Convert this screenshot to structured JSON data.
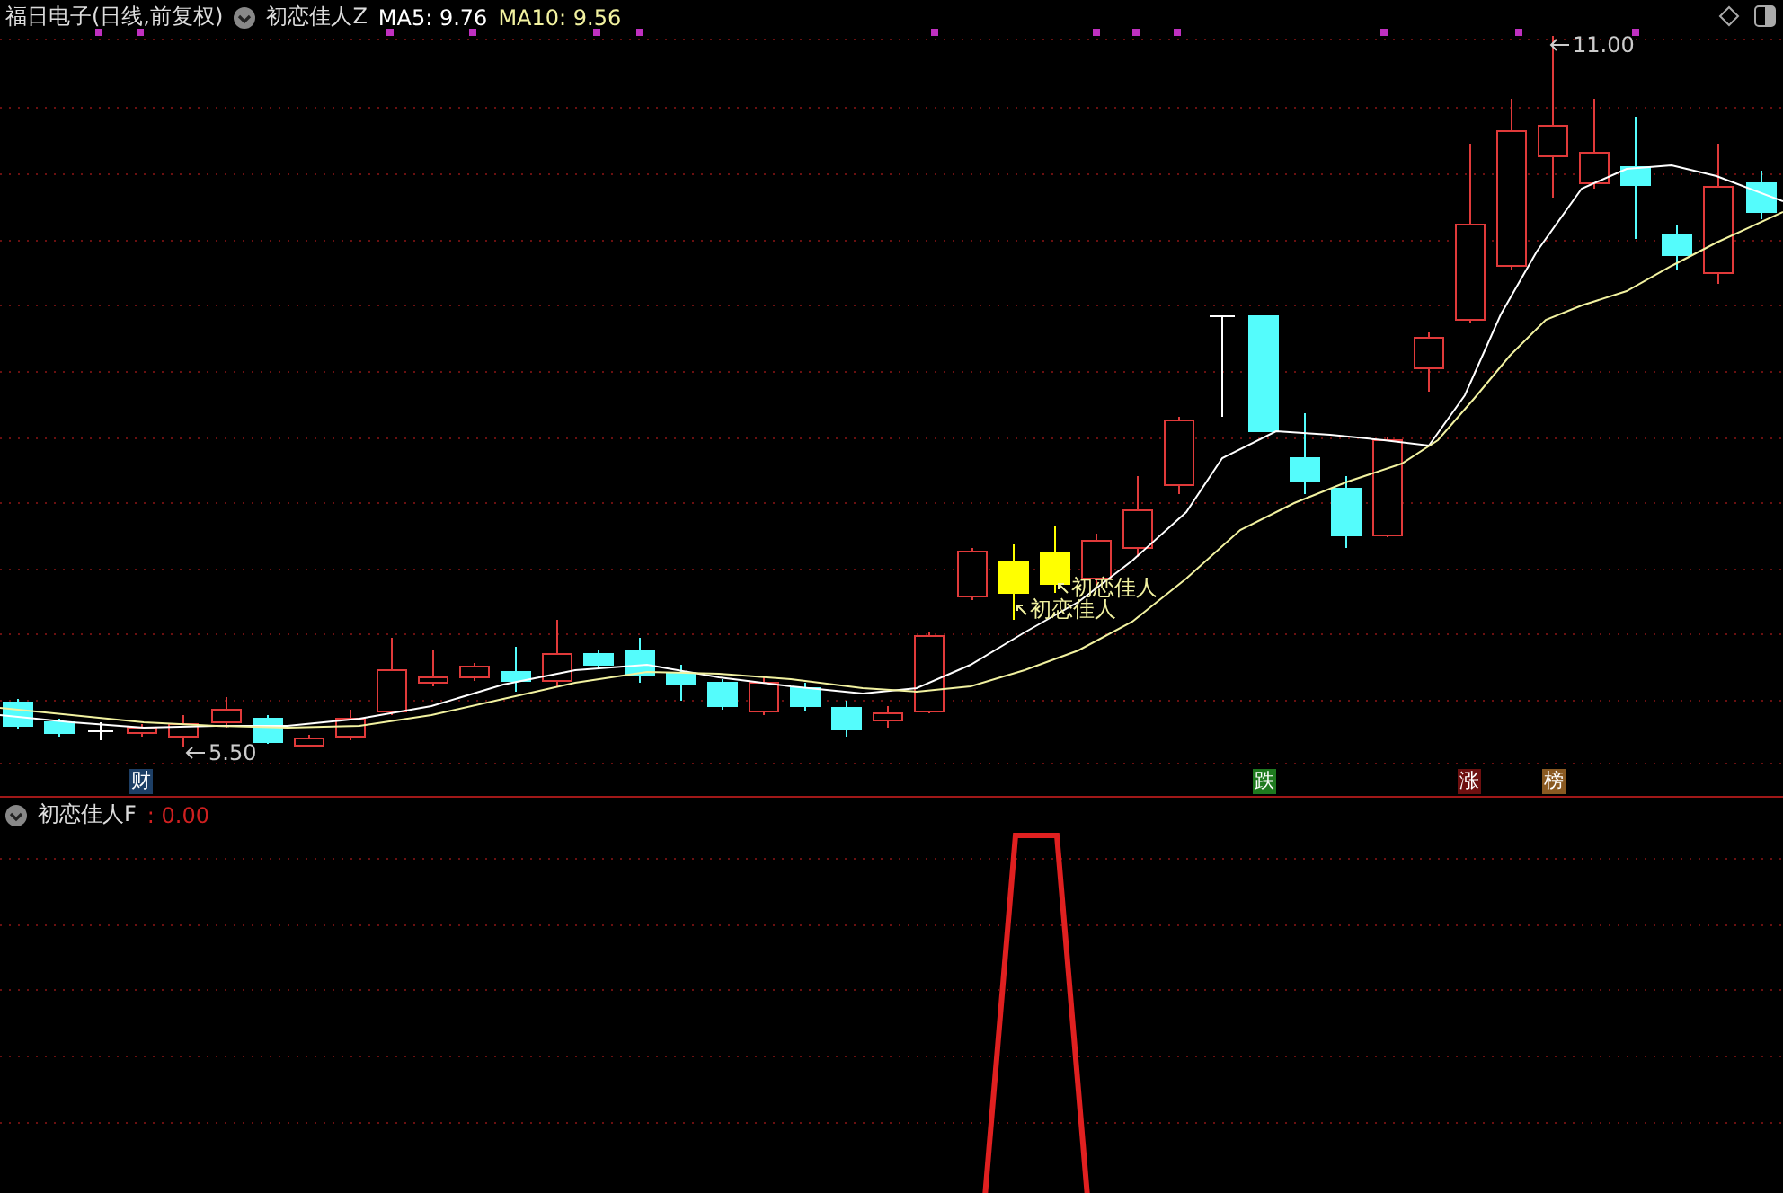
{
  "header": {
    "title": "福日电子(日线,前复权)",
    "indicator": "初恋佳人Z",
    "ma": [
      {
        "label": "MA5: 9.76",
        "color": "#ffffff"
      },
      {
        "label": "MA10: 9.56",
        "color": "#f2f2a0"
      }
    ]
  },
  "price_labels": [
    {
      "text": "11.00"
    },
    {
      "text": "5.50"
    }
  ],
  "signals": [
    {
      "text": "初恋佳人"
    },
    {
      "text": "初恋佳人"
    }
  ],
  "event_markers": [
    {
      "text": "财",
      "color": "#1d3f66"
    },
    {
      "text": "跌",
      "color": "#1f7a1f"
    },
    {
      "text": "涨",
      "color": "#6e1010"
    },
    {
      "text": "榜",
      "color": "#8a5a22"
    }
  ],
  "sub_panel": {
    "indicator": "初恋佳人F",
    "value": ": 0.00"
  }
}
